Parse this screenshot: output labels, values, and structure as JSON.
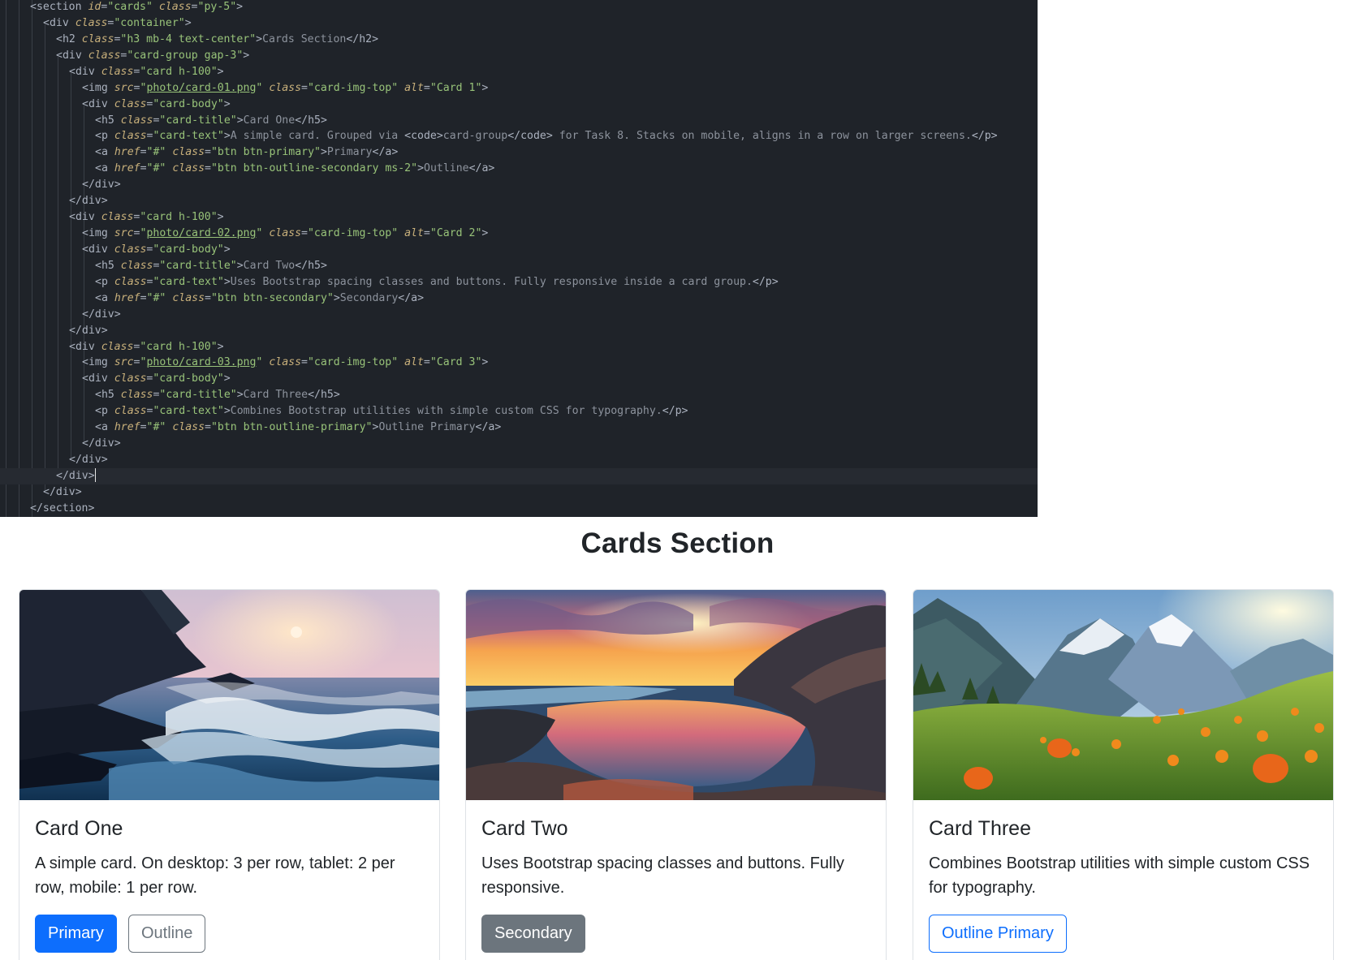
{
  "editor": {
    "lines": [
      [
        [
          "t-tag",
          "<section "
        ],
        [
          "t-attr",
          "id"
        ],
        [
          "t-tag",
          "="
        ],
        [
          "t-str",
          "\"cards\""
        ],
        [
          "t-tag",
          " "
        ],
        [
          "t-attr",
          "class"
        ],
        [
          "t-tag",
          "="
        ],
        [
          "t-str",
          "\"py-5\""
        ],
        [
          "t-tag",
          ">"
        ]
      ],
      [
        [
          "t-tag",
          "<div "
        ],
        [
          "t-attr",
          "class"
        ],
        [
          "t-tag",
          "="
        ],
        [
          "t-str",
          "\"container\""
        ],
        [
          "t-tag",
          ">"
        ]
      ],
      [
        [
          "t-tag",
          "<h2 "
        ],
        [
          "t-attr",
          "class"
        ],
        [
          "t-tag",
          "="
        ],
        [
          "t-str",
          "\"h3 mb-4 text-center\""
        ],
        [
          "t-tag",
          ">"
        ],
        [
          "t-text",
          "Cards Section"
        ],
        [
          "t-tag",
          "</h2>"
        ]
      ],
      [
        [
          "t-tag",
          "<div "
        ],
        [
          "t-attr",
          "class"
        ],
        [
          "t-tag",
          "="
        ],
        [
          "t-str",
          "\"card-group gap-3\""
        ],
        [
          "t-tag",
          ">"
        ]
      ],
      [
        [
          "t-tag",
          "<div "
        ],
        [
          "t-attr",
          "class"
        ],
        [
          "t-tag",
          "="
        ],
        [
          "t-str",
          "\"card h-100\""
        ],
        [
          "t-tag",
          ">"
        ]
      ],
      [
        [
          "t-tag",
          "<img "
        ],
        [
          "t-attr",
          "src"
        ],
        [
          "t-tag",
          "="
        ],
        [
          "t-str",
          "\""
        ],
        [
          "t-link",
          "photo/card-01.png"
        ],
        [
          "t-str",
          "\""
        ],
        [
          "t-tag",
          " "
        ],
        [
          "t-attr",
          "class"
        ],
        [
          "t-tag",
          "="
        ],
        [
          "t-str",
          "\"card-img-top\""
        ],
        [
          "t-tag",
          " "
        ],
        [
          "t-attr",
          "alt"
        ],
        [
          "t-tag",
          "="
        ],
        [
          "t-str",
          "\"Card 1\""
        ],
        [
          "t-tag",
          ">"
        ]
      ],
      [
        [
          "t-tag",
          "<div "
        ],
        [
          "t-attr",
          "class"
        ],
        [
          "t-tag",
          "="
        ],
        [
          "t-str",
          "\"card-body\""
        ],
        [
          "t-tag",
          ">"
        ]
      ],
      [
        [
          "t-tag",
          "<h5 "
        ],
        [
          "t-attr",
          "class"
        ],
        [
          "t-tag",
          "="
        ],
        [
          "t-str",
          "\"card-title\""
        ],
        [
          "t-tag",
          ">"
        ],
        [
          "t-text",
          "Card One"
        ],
        [
          "t-tag",
          "</h5>"
        ]
      ],
      [
        [
          "t-tag",
          "<p "
        ],
        [
          "t-attr",
          "class"
        ],
        [
          "t-tag",
          "="
        ],
        [
          "t-str",
          "\"card-text\""
        ],
        [
          "t-tag",
          ">"
        ],
        [
          "t-text",
          "A simple card. Grouped via "
        ],
        [
          "t-tag",
          "<code>"
        ],
        [
          "t-text",
          "card-group"
        ],
        [
          "t-tag",
          "</code>"
        ],
        [
          "t-text",
          " for Task 8. Stacks on mobile, aligns in a row on larger screens."
        ],
        [
          "t-tag",
          "</p>"
        ]
      ],
      [
        [
          "t-tag",
          "<a "
        ],
        [
          "t-attr",
          "href"
        ],
        [
          "t-tag",
          "="
        ],
        [
          "t-str",
          "\"#\""
        ],
        [
          "t-tag",
          " "
        ],
        [
          "t-attr",
          "class"
        ],
        [
          "t-tag",
          "="
        ],
        [
          "t-str",
          "\"btn btn-primary\""
        ],
        [
          "t-tag",
          ">"
        ],
        [
          "t-text",
          "Primary"
        ],
        [
          "t-tag",
          "</a>"
        ]
      ],
      [
        [
          "t-tag",
          "<a "
        ],
        [
          "t-attr",
          "href"
        ],
        [
          "t-tag",
          "="
        ],
        [
          "t-str",
          "\"#\""
        ],
        [
          "t-tag",
          " "
        ],
        [
          "t-attr",
          "class"
        ],
        [
          "t-tag",
          "="
        ],
        [
          "t-str",
          "\"btn btn-outline-secondary ms-2\""
        ],
        [
          "t-tag",
          ">"
        ],
        [
          "t-text",
          "Outline"
        ],
        [
          "t-tag",
          "</a>"
        ]
      ],
      [
        [
          "t-tag",
          "</div>"
        ]
      ],
      [
        [
          "t-tag",
          "</div>"
        ]
      ],
      [
        [
          "t-tag",
          "<div "
        ],
        [
          "t-attr",
          "class"
        ],
        [
          "t-tag",
          "="
        ],
        [
          "t-str",
          "\"card h-100\""
        ],
        [
          "t-tag",
          ">"
        ]
      ],
      [
        [
          "t-tag",
          "<img "
        ],
        [
          "t-attr",
          "src"
        ],
        [
          "t-tag",
          "="
        ],
        [
          "t-str",
          "\""
        ],
        [
          "t-link",
          "photo/card-02.png"
        ],
        [
          "t-str",
          "\""
        ],
        [
          "t-tag",
          " "
        ],
        [
          "t-attr",
          "class"
        ],
        [
          "t-tag",
          "="
        ],
        [
          "t-str",
          "\"card-img-top\""
        ],
        [
          "t-tag",
          " "
        ],
        [
          "t-attr",
          "alt"
        ],
        [
          "t-tag",
          "="
        ],
        [
          "t-str",
          "\"Card 2\""
        ],
        [
          "t-tag",
          ">"
        ]
      ],
      [
        [
          "t-tag",
          "<div "
        ],
        [
          "t-attr",
          "class"
        ],
        [
          "t-tag",
          "="
        ],
        [
          "t-str",
          "\"card-body\""
        ],
        [
          "t-tag",
          ">"
        ]
      ],
      [
        [
          "t-tag",
          "<h5 "
        ],
        [
          "t-attr",
          "class"
        ],
        [
          "t-tag",
          "="
        ],
        [
          "t-str",
          "\"card-title\""
        ],
        [
          "t-tag",
          ">"
        ],
        [
          "t-text",
          "Card Two"
        ],
        [
          "t-tag",
          "</h5>"
        ]
      ],
      [
        [
          "t-tag",
          "<p "
        ],
        [
          "t-attr",
          "class"
        ],
        [
          "t-tag",
          "="
        ],
        [
          "t-str",
          "\"card-text\""
        ],
        [
          "t-tag",
          ">"
        ],
        [
          "t-text",
          "Uses Bootstrap spacing classes and buttons. Fully responsive inside a card group."
        ],
        [
          "t-tag",
          "</p>"
        ]
      ],
      [
        [
          "t-tag",
          "<a "
        ],
        [
          "t-attr",
          "href"
        ],
        [
          "t-tag",
          "="
        ],
        [
          "t-str",
          "\"#\""
        ],
        [
          "t-tag",
          " "
        ],
        [
          "t-attr",
          "class"
        ],
        [
          "t-tag",
          "="
        ],
        [
          "t-str",
          "\"btn btn-secondary\""
        ],
        [
          "t-tag",
          ">"
        ],
        [
          "t-text",
          "Secondary"
        ],
        [
          "t-tag",
          "</a>"
        ]
      ],
      [
        [
          "t-tag",
          "</div>"
        ]
      ],
      [
        [
          "t-tag",
          "</div>"
        ]
      ],
      [
        [
          "t-tag",
          "<div "
        ],
        [
          "t-attr",
          "class"
        ],
        [
          "t-tag",
          "="
        ],
        [
          "t-str",
          "\"card h-100\""
        ],
        [
          "t-tag",
          ">"
        ]
      ],
      [
        [
          "t-tag",
          "<img "
        ],
        [
          "t-attr",
          "src"
        ],
        [
          "t-tag",
          "="
        ],
        [
          "t-str",
          "\""
        ],
        [
          "t-link",
          "photo/card-03.png"
        ],
        [
          "t-str",
          "\""
        ],
        [
          "t-tag",
          " "
        ],
        [
          "t-attr",
          "class"
        ],
        [
          "t-tag",
          "="
        ],
        [
          "t-str",
          "\"card-img-top\""
        ],
        [
          "t-tag",
          " "
        ],
        [
          "t-attr",
          "alt"
        ],
        [
          "t-tag",
          "="
        ],
        [
          "t-str",
          "\"Card 3\""
        ],
        [
          "t-tag",
          ">"
        ]
      ],
      [
        [
          "t-tag",
          "<div "
        ],
        [
          "t-attr",
          "class"
        ],
        [
          "t-tag",
          "="
        ],
        [
          "t-str",
          "\"card-body\""
        ],
        [
          "t-tag",
          ">"
        ]
      ],
      [
        [
          "t-tag",
          "<h5 "
        ],
        [
          "t-attr",
          "class"
        ],
        [
          "t-tag",
          "="
        ],
        [
          "t-str",
          "\"card-title\""
        ],
        [
          "t-tag",
          ">"
        ],
        [
          "t-text",
          "Card Three"
        ],
        [
          "t-tag",
          "</h5>"
        ]
      ],
      [
        [
          "t-tag",
          "<p "
        ],
        [
          "t-attr",
          "class"
        ],
        [
          "t-tag",
          "="
        ],
        [
          "t-str",
          "\"card-text\""
        ],
        [
          "t-tag",
          ">"
        ],
        [
          "t-text",
          "Combines Bootstrap utilities with simple custom CSS for typography."
        ],
        [
          "t-tag",
          "</p>"
        ]
      ],
      [
        [
          "t-tag",
          "<a "
        ],
        [
          "t-attr",
          "href"
        ],
        [
          "t-tag",
          "="
        ],
        [
          "t-str",
          "\"#\""
        ],
        [
          "t-tag",
          " "
        ],
        [
          "t-attr",
          "class"
        ],
        [
          "t-tag",
          "="
        ],
        [
          "t-str",
          "\"btn btn-outline-primary\""
        ],
        [
          "t-tag",
          ">"
        ],
        [
          "t-text",
          "Outline Primary"
        ],
        [
          "t-tag",
          "</a>"
        ]
      ],
      [
        [
          "t-tag",
          "</div>"
        ]
      ],
      [
        [
          "t-tag",
          "</div>"
        ]
      ],
      [
        [
          "t-tag",
          "</div>"
        ]
      ],
      [
        [
          "t-tag",
          "</div>"
        ]
      ],
      [
        [
          "t-tag",
          "</section>"
        ]
      ]
    ],
    "indents": [
      0,
      1,
      2,
      2,
      3,
      4,
      4,
      5,
      5,
      5,
      5,
      4,
      3,
      3,
      4,
      4,
      5,
      5,
      5,
      4,
      3,
      3,
      4,
      4,
      5,
      5,
      5,
      4,
      3,
      2,
      1,
      0
    ],
    "active_line": 29,
    "colors": {
      "background": "#1f2329",
      "tag": "#abb2bf",
      "attribute": "#c8b07b",
      "string": "#98c379",
      "text": "#8d939d"
    }
  },
  "preview": {
    "title": "Cards Section",
    "cards": [
      {
        "image_alt": "Card 1",
        "image_icon": "ocean-waves-sunset-photo",
        "title": "Card One",
        "text": "A simple card. On desktop: 3 per row, tablet: 2 per row, mobile: 1 per row.",
        "buttons": [
          {
            "label": "Primary",
            "style": "btn-primary"
          },
          {
            "label": "Outline",
            "style": "btn-outline-secondary"
          }
        ]
      },
      {
        "image_alt": "Card 2",
        "image_icon": "tidepool-sunset-photo",
        "title": "Card Two",
        "text": "Uses Bootstrap spacing classes and buttons. Fully responsive.",
        "buttons": [
          {
            "label": "Secondary",
            "style": "btn-secondary"
          }
        ]
      },
      {
        "image_alt": "Card 3",
        "image_icon": "mountain-meadow-flowers-photo",
        "title": "Card Three",
        "text": "Combines Bootstrap utilities with simple custom CSS for typography.",
        "buttons": [
          {
            "label": "Outline Primary",
            "style": "btn-outline-primary"
          }
        ]
      }
    ],
    "colors": {
      "primary": "#0d6efd",
      "secondary": "#6c757d",
      "border": "#dee2e6",
      "text": "#212529"
    }
  }
}
